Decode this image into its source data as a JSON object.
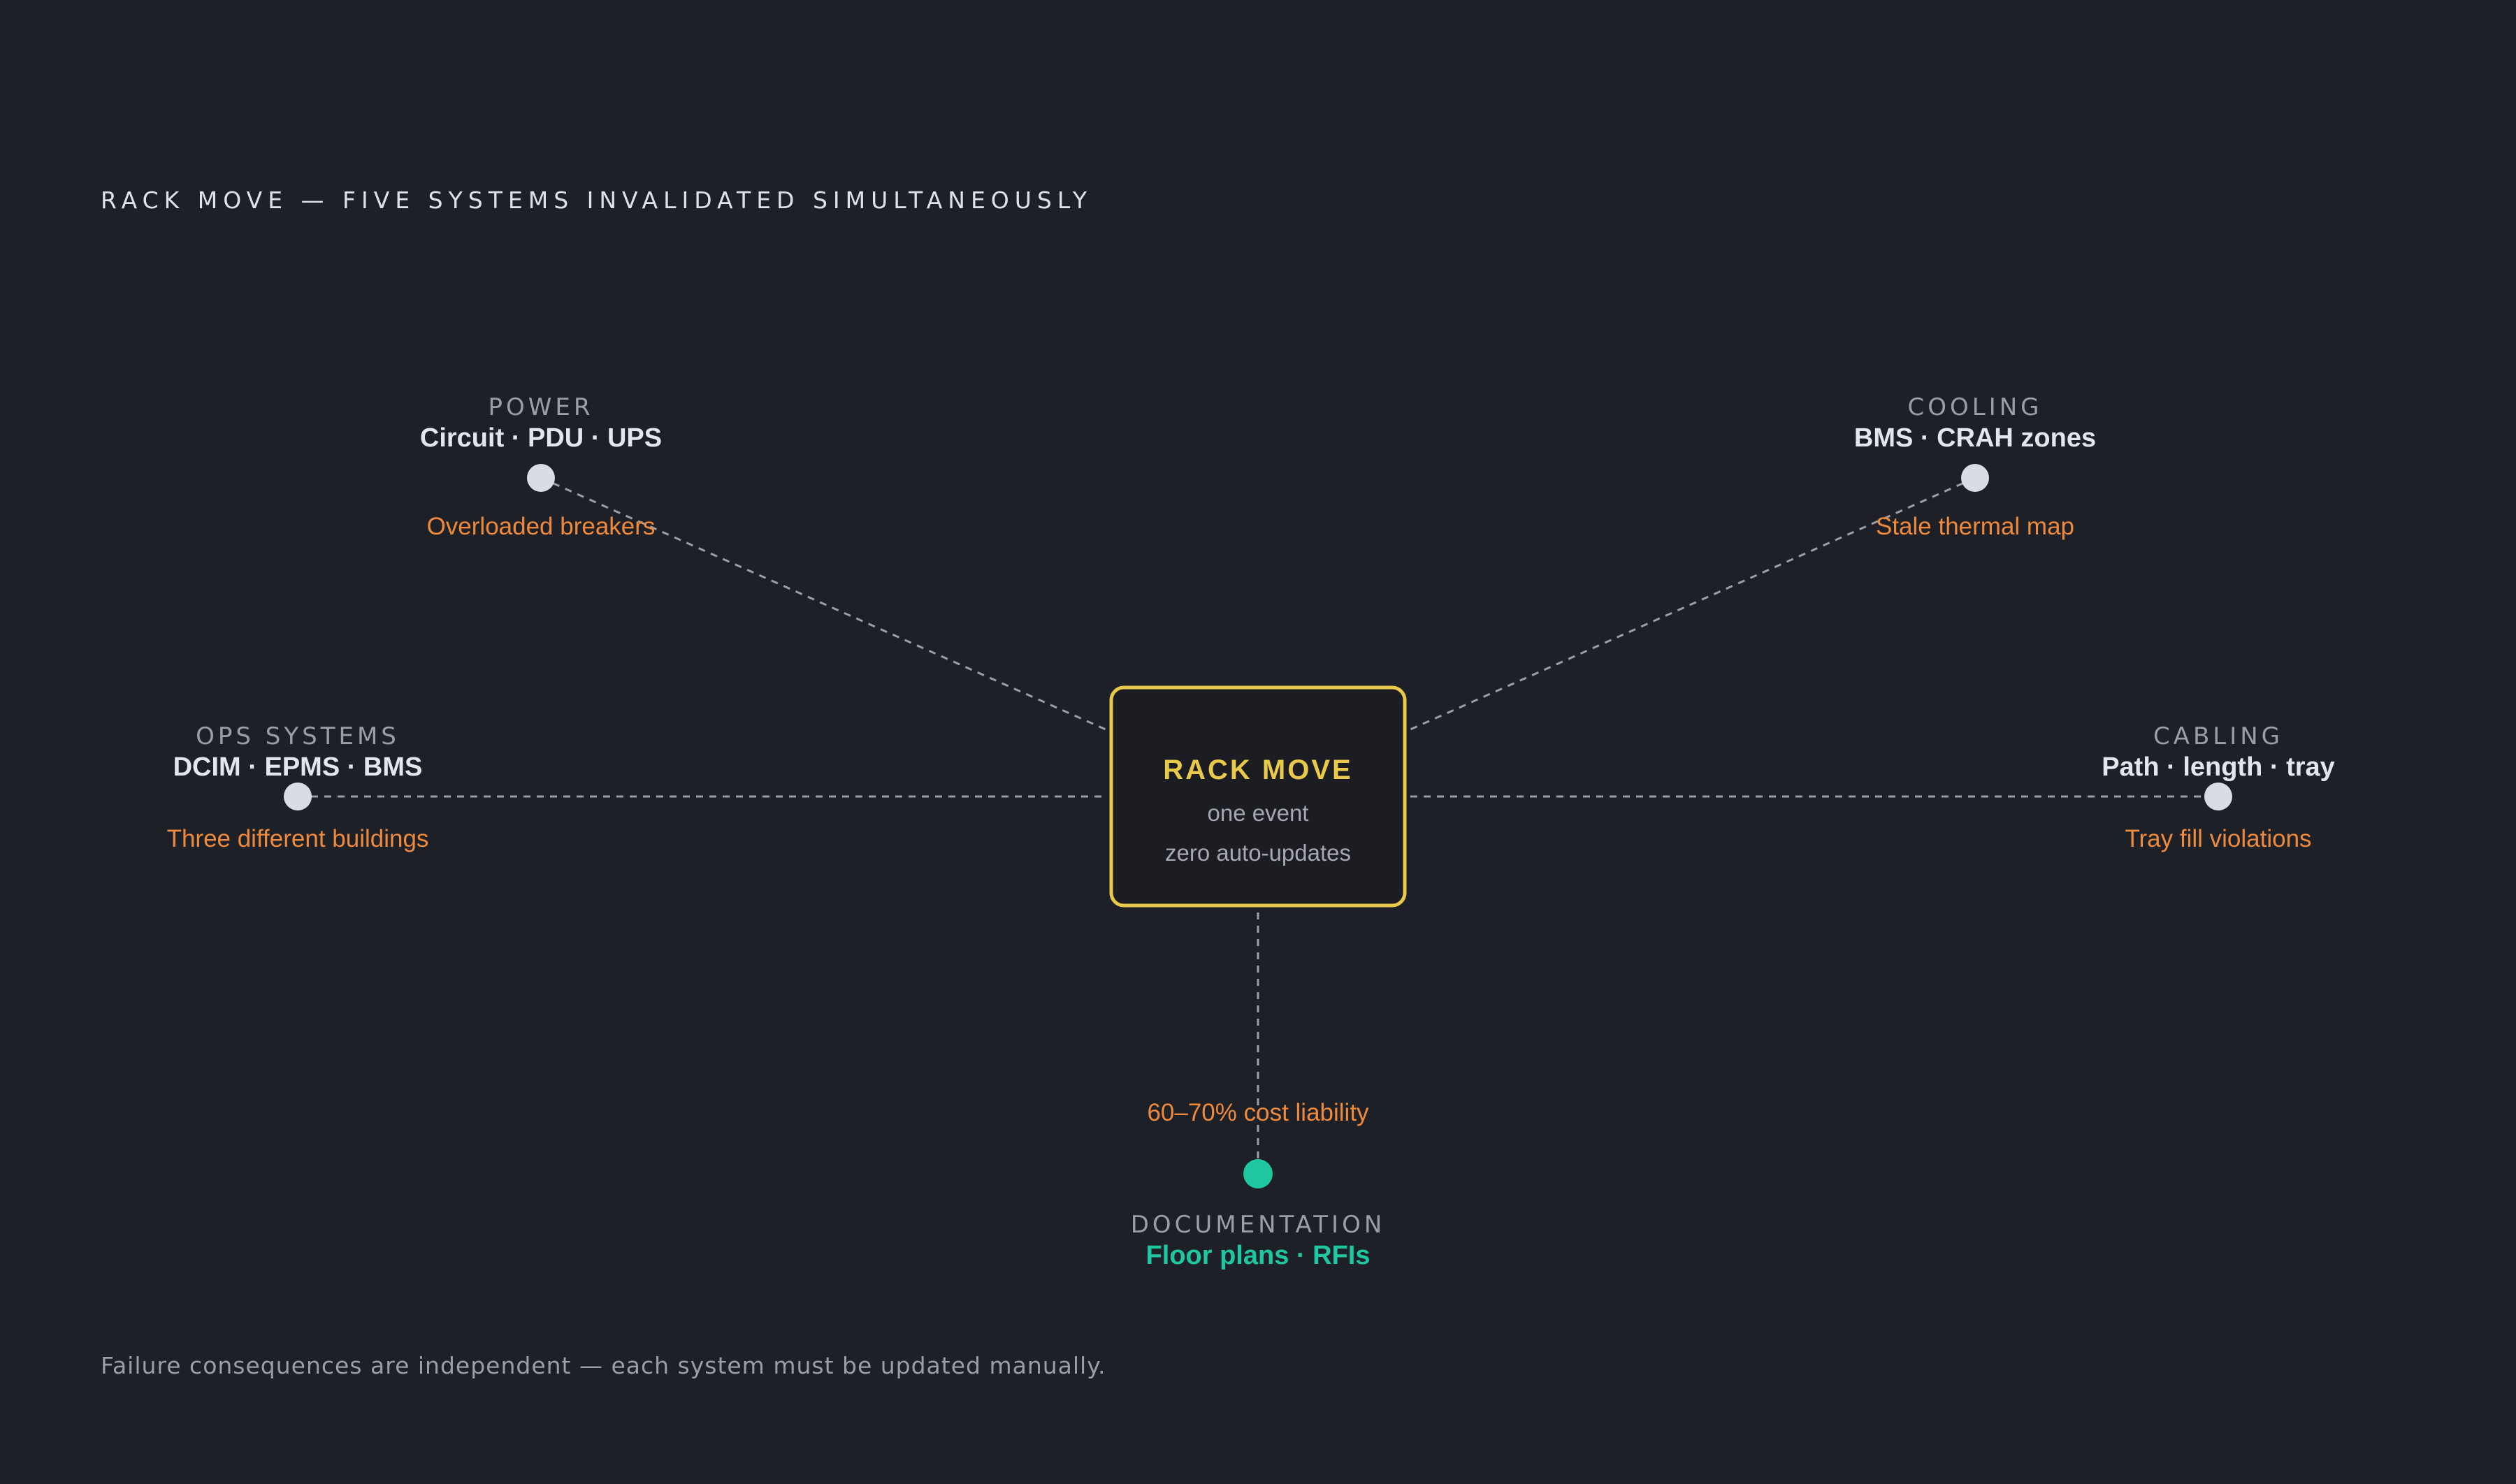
{
  "title": "RACK MOVE — FIVE SYSTEMS INVALIDATED SIMULTANEOUSLY",
  "center": {
    "title": "RACK MOVE",
    "line1": "one event",
    "line2": "zero auto-updates"
  },
  "nodes": {
    "power": {
      "category": "POWER",
      "systems": "Circuit · PDU · UPS",
      "failure": "Overloaded breakers"
    },
    "cooling": {
      "category": "COOLING",
      "systems": "BMS · CRAH zones",
      "failure": "Stale thermal map"
    },
    "ops": {
      "category": "OPS SYSTEMS",
      "systems": "DCIM · EPMS · BMS",
      "failure": "Three different buildings"
    },
    "cabling": {
      "category": "CABLING",
      "systems": "Path · length · tray",
      "failure": "Tray fill violations"
    },
    "documentation": {
      "category": "DOCUMENTATION",
      "systems": "Floor plans · RFIs",
      "failure": "60–70% cost liability"
    }
  },
  "footnote": "Failure consequences are independent — each system must be updated manually.",
  "colors": {
    "background": "#1d2027",
    "center_border": "#e8c94a",
    "failure_text": "#ef8a3c",
    "documentation_accent": "#1fc7a0",
    "node_dot": "#d9dce3"
  }
}
